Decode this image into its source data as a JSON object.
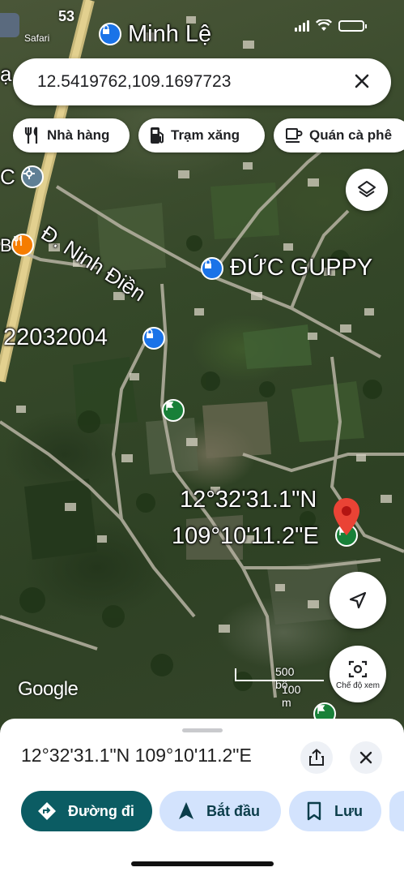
{
  "status_bar": {
    "time": "53",
    "back_label": "Safari"
  },
  "search": {
    "value": "12.5419762,109.1697723"
  },
  "chips": [
    {
      "label": "Nhà hàng",
      "icon": "restaurant-icon"
    },
    {
      "label": "Trạm xăng",
      "icon": "gas-station-icon"
    },
    {
      "label": "Quán cà phê",
      "icon": "coffee-icon"
    }
  ],
  "map": {
    "labels": {
      "town": "Minh Lệ",
      "road": "Đ. Ninh Điền",
      "shop": "ĐỨC GUPPY",
      "shop_code": "22032004",
      "left_edge_top": "ạ",
      "left_edge_c": "C",
      "left_edge_b": "B"
    },
    "pin_coord_line1": "12°32'31.1\"N",
    "pin_coord_line2": "109°10'11.2\"E",
    "scale_imperial": "500 bộ",
    "scale_metric": "100 m",
    "attribution": "Google",
    "view_mode_label": "Chế độ xem"
  },
  "sheet": {
    "coordinates": "12°32'31.1\"N 109°10'11.2\"E",
    "actions": [
      {
        "label": "Đường đi",
        "icon": "directions-icon"
      },
      {
        "label": "Bắt đầu",
        "icon": "navigation-icon"
      },
      {
        "label": "Lưu",
        "icon": "bookmark-icon"
      }
    ]
  },
  "colors": {
    "accent": "#0b5c63",
    "chip_blue": "#d3e3fd",
    "pin": "#ea4335",
    "poi_blue": "#1a73e8",
    "poi_green": "#188038",
    "poi_orange": "#f57c00"
  }
}
